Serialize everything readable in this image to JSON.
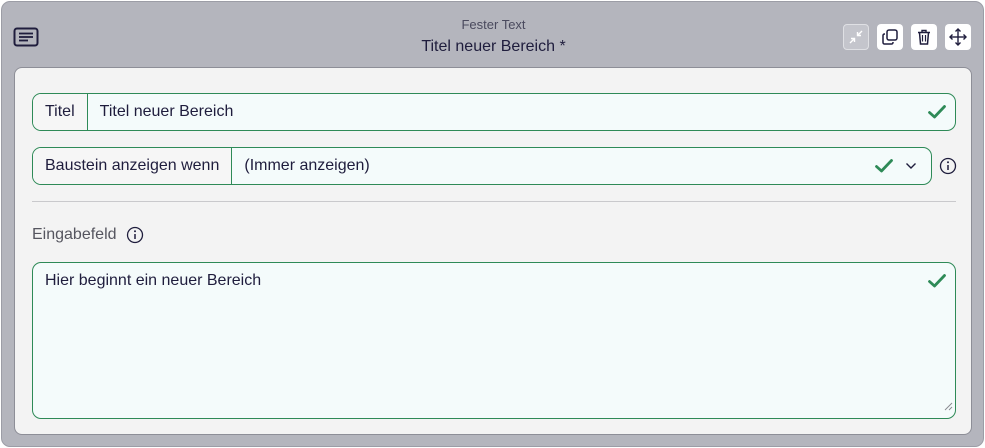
{
  "header": {
    "subtitle": "Fester Text",
    "title": "Titel neuer Bereich *"
  },
  "toolbar": {
    "icons": [
      "collapse-icon",
      "copy-icon",
      "trash-icon",
      "move-icon"
    ],
    "collapse_disabled": true
  },
  "fields": {
    "title_label": "Titel",
    "title_value": "Titel neuer Bereich",
    "condition_label": "Baustein anzeigen wenn",
    "condition_value": "(Immer anzeigen)",
    "input_label": "Eingabefeld",
    "input_value": "Hier beginnt ein neuer Bereich"
  },
  "colors": {
    "accent_green": "#2e8a57",
    "header_bg": "#b4b5bd",
    "panel_bg": "#f3f3f3",
    "text": "#1f1d3d"
  }
}
